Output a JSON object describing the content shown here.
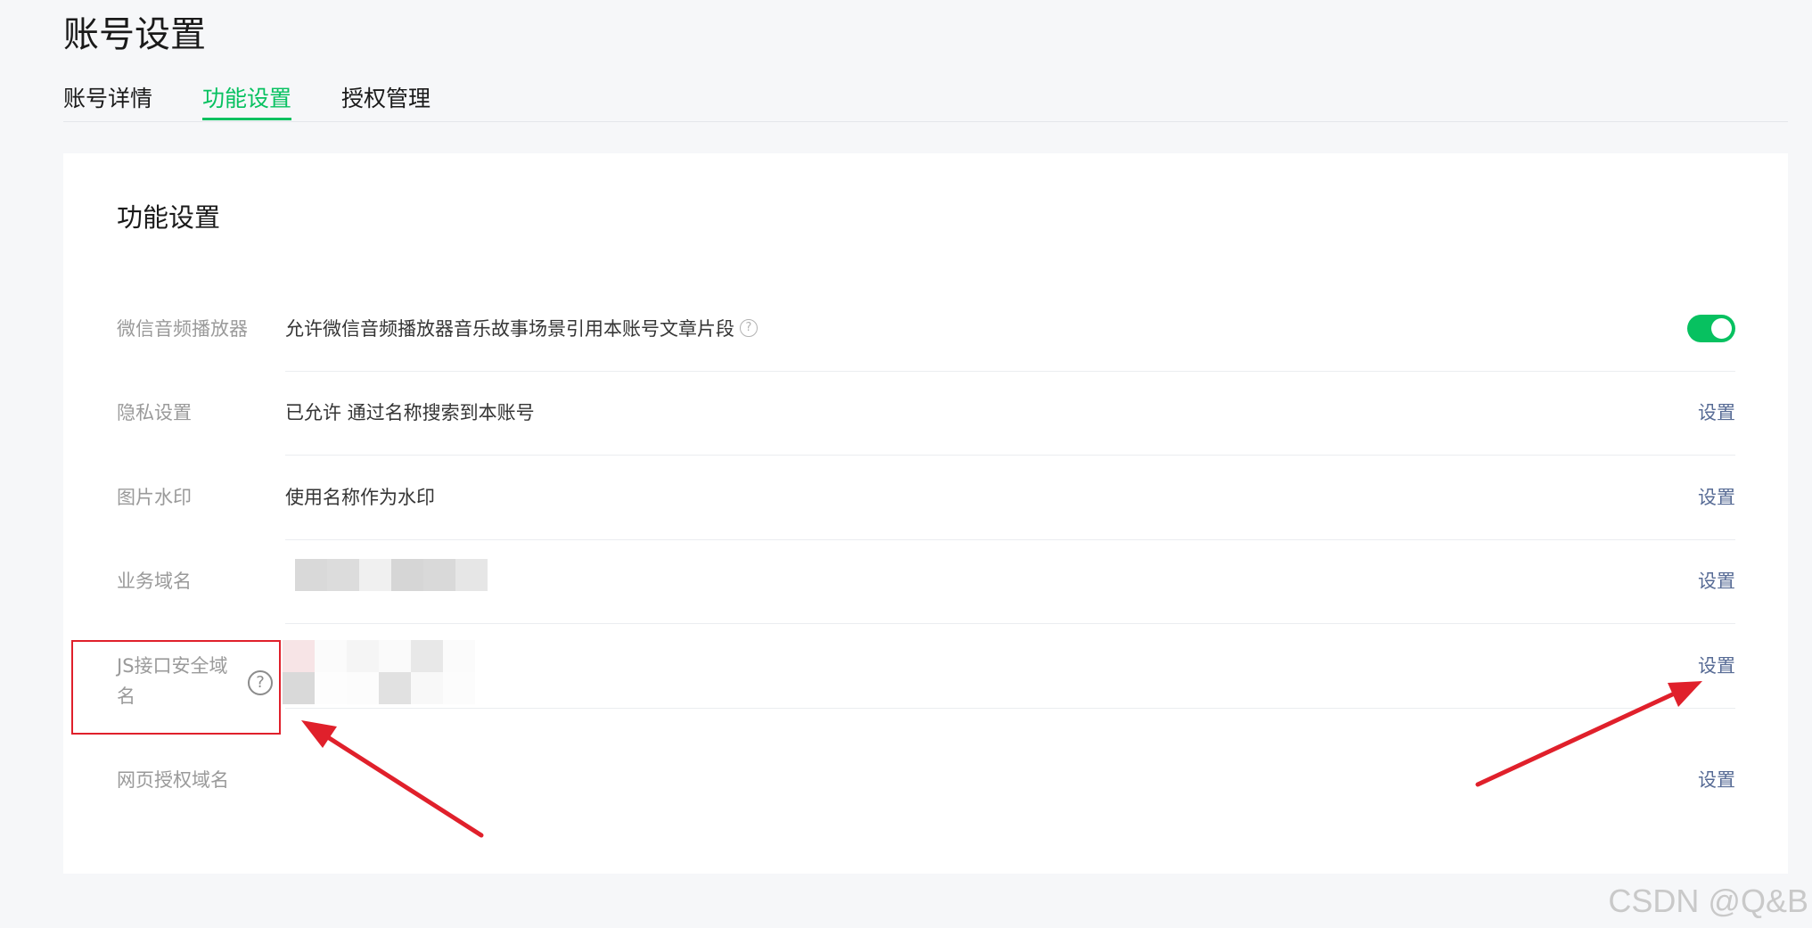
{
  "page": {
    "title": "账号设置"
  },
  "tabs": [
    {
      "label": "账号详情",
      "active": false
    },
    {
      "label": "功能设置",
      "active": true
    },
    {
      "label": "授权管理",
      "active": false
    }
  ],
  "card": {
    "title": "功能设置"
  },
  "rows": [
    {
      "label": "微信音频播放器",
      "value": "允许微信音频播放器音乐故事场景引用本账号文章片段",
      "help_icon": "question-circle-icon",
      "control": "toggle",
      "toggle_on": true
    },
    {
      "label": "隐私设置",
      "value": "已允许 通过名称搜索到本账号",
      "action": "设置"
    },
    {
      "label": "图片水印",
      "value": "使用名称作为水印",
      "action": "设置"
    },
    {
      "label": "业务域名",
      "value_hidden": true,
      "action": "设置"
    },
    {
      "label": "JS接口安全域名",
      "help_icon": "question-circle-icon",
      "value_hidden": true,
      "action": "设置"
    },
    {
      "label": "网页授权域名",
      "action": "设置"
    }
  ],
  "icons": {
    "help": "?"
  },
  "annotation": {
    "box_color": "#e0202b",
    "arrow_color": "#e0202b"
  },
  "watermark": "CSDN @Q&B",
  "colors": {
    "accent": "#07c160",
    "link": "#576b95",
    "label": "#9a9a9a"
  }
}
